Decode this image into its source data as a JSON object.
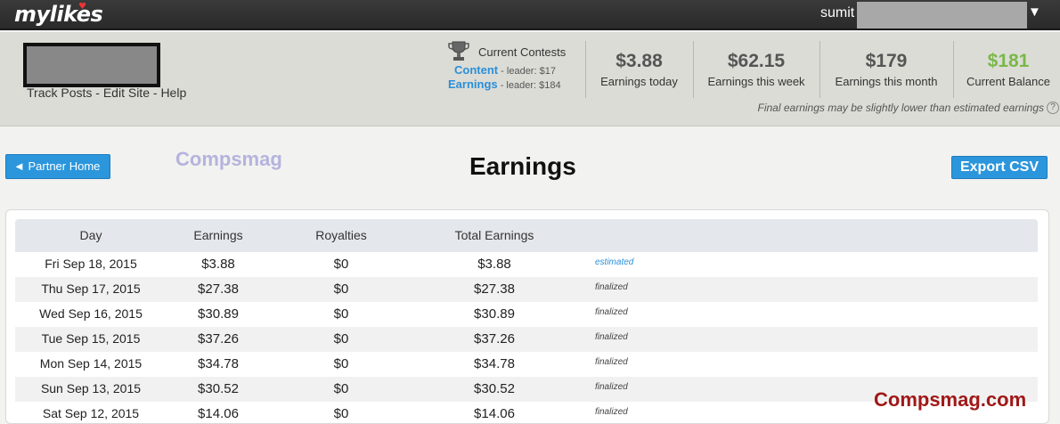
{
  "topbar": {
    "logo": "mylikes",
    "user_name": "sumit",
    "caret": "▼"
  },
  "site_links": {
    "track_posts": "Track Posts",
    "sep1": " - ",
    "edit_site": "Edit Site",
    "sep2": " - ",
    "help": "Help"
  },
  "contests": {
    "title": "Current Contests",
    "items": [
      {
        "name": "Content",
        "leader": "- leader: $17"
      },
      {
        "name": "Earnings",
        "leader": "- leader: $184"
      }
    ]
  },
  "stats": [
    {
      "value": "$3.88",
      "label": "Earnings today"
    },
    {
      "value": "$62.15",
      "label": "Earnings this week"
    },
    {
      "value": "$179",
      "label": "Earnings this month"
    },
    {
      "value": "$181",
      "label": "Current Balance"
    }
  ],
  "disclaimer": "Final earnings may be slightly lower than estimated earnings",
  "help_glyph": "?",
  "buttons": {
    "partner_home": "◄ Partner Home",
    "export_csv": "Export CSV"
  },
  "watermark_top": "Compsmag",
  "page_title": "Earnings",
  "table": {
    "headers": [
      "Day",
      "Earnings",
      "Royalties",
      "Total Earnings"
    ],
    "rows": [
      {
        "day": "Fri Sep 18, 2015",
        "earnings": "$3.88",
        "royalties": "$0",
        "total": "$3.88",
        "status": "estimated"
      },
      {
        "day": "Thu Sep 17, 2015",
        "earnings": "$27.38",
        "royalties": "$0",
        "total": "$27.38",
        "status": "finalized"
      },
      {
        "day": "Wed Sep 16, 2015",
        "earnings": "$30.89",
        "royalties": "$0",
        "total": "$30.89",
        "status": "finalized"
      },
      {
        "day": "Tue Sep 15, 2015",
        "earnings": "$37.26",
        "royalties": "$0",
        "total": "$37.26",
        "status": "finalized"
      },
      {
        "day": "Mon Sep 14, 2015",
        "earnings": "$34.78",
        "royalties": "$0",
        "total": "$34.78",
        "status": "finalized"
      },
      {
        "day": "Sun Sep 13, 2015",
        "earnings": "$30.52",
        "royalties": "$0",
        "total": "$30.52",
        "status": "finalized"
      },
      {
        "day": "Sat Sep 12, 2015",
        "earnings": "$14.06",
        "royalties": "$0",
        "total": "$14.06",
        "status": "finalized"
      }
    ]
  },
  "watermark_bottom": "Compsmag.com",
  "colors": {
    "accent_blue": "#2b96dc",
    "balance_green": "#7ab84a",
    "watermark_red": "#a01818"
  }
}
